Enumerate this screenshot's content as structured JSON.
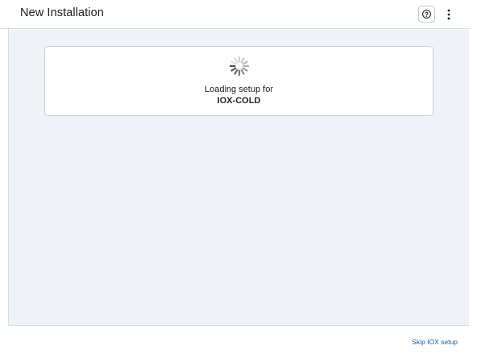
{
  "header": {
    "title": "New Installation",
    "help_icon": "help-circle-icon",
    "more_icon": "more-vertical-icon"
  },
  "main": {
    "spinner_icon": "loading-spinner-icon",
    "loading_text": "Loading setup for",
    "device_name": "IOX-COLD"
  },
  "footer": {
    "skip_label": "Skip IOX setup"
  },
  "colors": {
    "background": "#eff3f7",
    "link": "#1a5fa8",
    "border": "#d6dbe0"
  }
}
